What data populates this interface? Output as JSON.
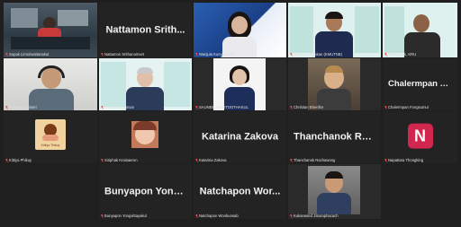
{
  "participants": [
    {
      "id": "p1",
      "label": "Supak Limsriwattanakul",
      "kind": "camera"
    },
    {
      "id": "p2",
      "label": "Nattamon Srithanomvet",
      "big_name": "Nattamon Srith...",
      "kind": "name"
    },
    {
      "id": "p3",
      "label": "Wanjula Kumar Yasin",
      "kind": "camera"
    },
    {
      "id": "p4",
      "label": "Jumin Kumpakan (KMUTNB)",
      "kind": "camera"
    },
    {
      "id": "p5",
      "label": "Nattanjirak, KRU",
      "kind": "camera"
    },
    {
      "id": "p6",
      "label": "Pongsak Srimeri",
      "kind": "camera"
    },
    {
      "id": "p7",
      "label": "Pongsak Kamnan",
      "kind": "camera"
    },
    {
      "id": "p8",
      "label": "SAUNEE SRIVITOOTHAKUL",
      "kind": "camera"
    },
    {
      "id": "p9",
      "label": "Christian Ebenflor",
      "kind": "camera"
    },
    {
      "id": "p10",
      "label": "Chalermpan Fongsumut",
      "big_name": "Chalermpan Fon...",
      "kind": "name"
    },
    {
      "id": "p11",
      "label": "Kittiya Phikuy",
      "logo_text": "Kittiya Thikuy",
      "kind": "logo"
    },
    {
      "id": "p12",
      "label": "Siriphak Kraisaeron",
      "kind": "camera"
    },
    {
      "id": "p13",
      "label": "Katarina Zakova",
      "big_name": "Katarina Zakova",
      "kind": "name"
    },
    {
      "id": "p14",
      "label": "Thanchanok Rachawong",
      "big_name": "Thanchanok Rac...",
      "kind": "name"
    },
    {
      "id": "p15",
      "label": "Napattara Thongking",
      "avatar_letter": "N",
      "kind": "avatar"
    },
    {
      "id": "p16",
      "label": "Bunyapon Yongvittayakul",
      "big_name": "Bunyapon Yong...",
      "kind": "name"
    },
    {
      "id": "p17",
      "label": "Natchapon Wonbunsab",
      "big_name": "Natchapon Wor...",
      "kind": "name"
    },
    {
      "id": "p18",
      "label": "Kukanased Jaturaphacach",
      "kind": "camera"
    }
  ],
  "colors": {
    "active_border": "#c5e052",
    "avatar_bg": "#d1264d",
    "muted_mic": "#ff4a4a"
  }
}
